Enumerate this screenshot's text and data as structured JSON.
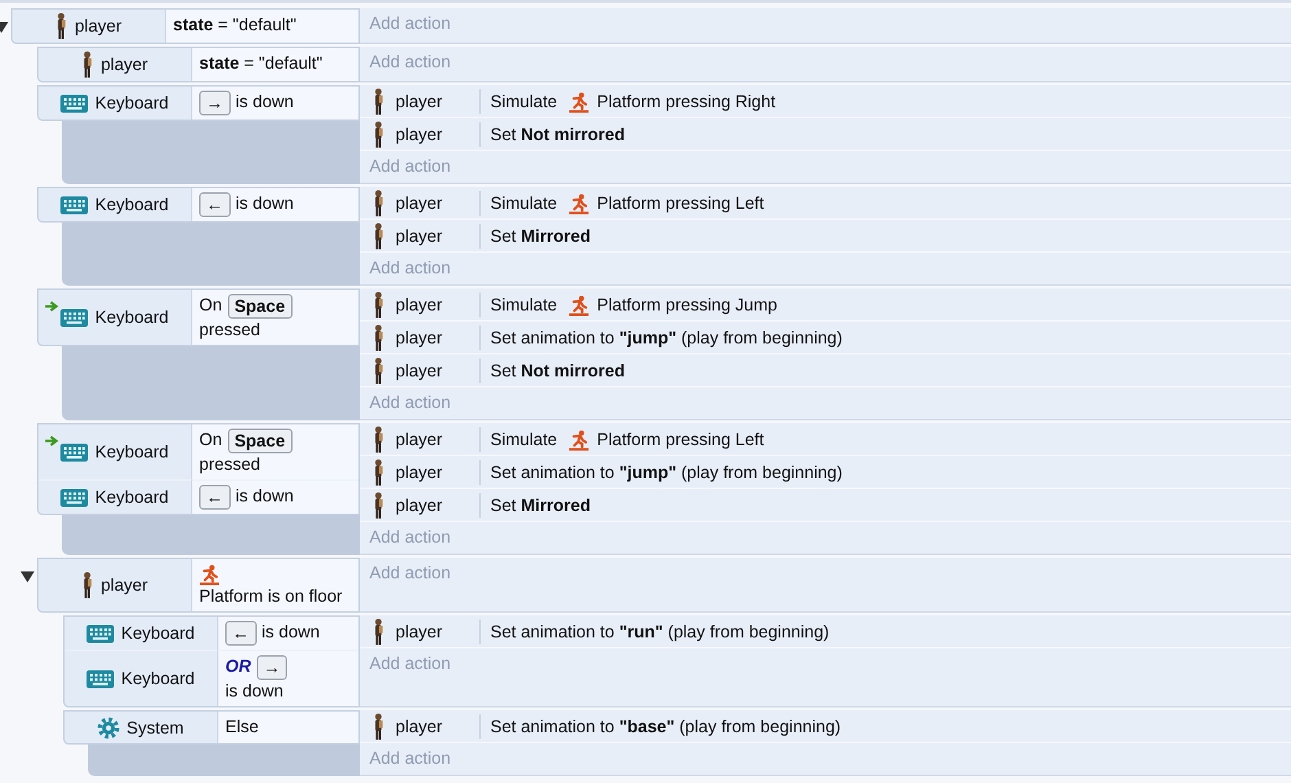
{
  "events": [
    {
      "expanded": true,
      "conditions": [
        {
          "object": "player",
          "kind": "sprite",
          "trigger": false,
          "parts": [
            {
              "kind": "text",
              "text": "**state** = \"default\""
            }
          ]
        }
      ],
      "add_action": "Add action",
      "children": [
        {
          "conditions": [
            {
              "object": "player",
              "kind": "sprite",
              "trigger": false,
              "parts": [
                {
                  "kind": "text",
                  "text": "**state** = \"default\""
                }
              ]
            }
          ],
          "add_action": "Add action"
        },
        {
          "conditions": [
            {
              "object": "Keyboard",
              "kind": "keyboard",
              "trigger": false,
              "parts": [
                {
                  "kind": "key",
                  "text": "→"
                },
                {
                  "kind": "text",
                  "text": "is down"
                }
              ]
            }
          ],
          "actions": [
            {
              "object": "player",
              "kind": "sprite",
              "parts": [
                {
                  "kind": "text",
                  "text": "Simulate"
                },
                {
                  "kind": "behavior"
                },
                {
                  "kind": "text",
                  "text": "Platform pressing Right"
                }
              ]
            },
            {
              "object": "player",
              "kind": "sprite",
              "parts": [
                {
                  "kind": "text",
                  "text": "Set **Not mirrored**"
                }
              ]
            }
          ],
          "add_action": "Add action"
        },
        {
          "conditions": [
            {
              "object": "Keyboard",
              "kind": "keyboard",
              "trigger": false,
              "parts": [
                {
                  "kind": "key",
                  "text": "←"
                },
                {
                  "kind": "text",
                  "text": "is down"
                }
              ]
            }
          ],
          "actions": [
            {
              "object": "player",
              "kind": "sprite",
              "parts": [
                {
                  "kind": "text",
                  "text": "Simulate"
                },
                {
                  "kind": "behavior"
                },
                {
                  "kind": "text",
                  "text": "Platform pressing Left"
                }
              ]
            },
            {
              "object": "player",
              "kind": "sprite",
              "parts": [
                {
                  "kind": "text",
                  "text": "Set **Mirrored**"
                }
              ]
            }
          ],
          "add_action": "Add action"
        },
        {
          "conditions": [
            {
              "object": "Keyboard",
              "kind": "keyboard",
              "trigger": true,
              "parts": [
                {
                  "kind": "text",
                  "text": "On"
                },
                {
                  "kind": "key",
                  "text": "Space"
                },
                {
                  "kind": "text",
                  "text": "pressed"
                }
              ]
            }
          ],
          "actions": [
            {
              "object": "player",
              "kind": "sprite",
              "parts": [
                {
                  "kind": "text",
                  "text": "Simulate"
                },
                {
                  "kind": "behavior"
                },
                {
                  "kind": "text",
                  "text": "Platform pressing Jump"
                }
              ]
            },
            {
              "object": "player",
              "kind": "sprite",
              "parts": [
                {
                  "kind": "text",
                  "text": "Set animation to **\"jump\"** (play from beginning)"
                }
              ]
            },
            {
              "object": "player",
              "kind": "sprite",
              "parts": [
                {
                  "kind": "text",
                  "text": "Set **Not mirrored**"
                }
              ]
            }
          ],
          "add_action": "Add action"
        },
        {
          "conditions": [
            {
              "object": "Keyboard",
              "kind": "keyboard",
              "trigger": true,
              "parts": [
                {
                  "kind": "text",
                  "text": "On"
                },
                {
                  "kind": "key",
                  "text": "Space"
                },
                {
                  "kind": "text",
                  "text": "pressed"
                }
              ]
            },
            {
              "object": "Keyboard",
              "kind": "keyboard",
              "trigger": false,
              "parts": [
                {
                  "kind": "key",
                  "text": "←"
                },
                {
                  "kind": "text",
                  "text": "is down"
                }
              ]
            }
          ],
          "actions": [
            {
              "object": "player",
              "kind": "sprite",
              "parts": [
                {
                  "kind": "text",
                  "text": "Simulate"
                },
                {
                  "kind": "behavior"
                },
                {
                  "kind": "text",
                  "text": "Platform pressing Left"
                }
              ]
            },
            {
              "object": "player",
              "kind": "sprite",
              "parts": [
                {
                  "kind": "text",
                  "text": "Set animation to **\"jump\"** (play from beginning)"
                }
              ]
            },
            {
              "object": "player",
              "kind": "sprite",
              "parts": [
                {
                  "kind": "text",
                  "text": "Set **Mirrored**"
                }
              ]
            }
          ],
          "add_action": "Add action"
        },
        {
          "expanded": true,
          "conditions": [
            {
              "object": "player",
              "kind": "sprite",
              "trigger": false,
              "parts": [
                {
                  "kind": "behavior"
                },
                {
                  "kind": "text",
                  "text": "Platform is on floor"
                }
              ]
            }
          ],
          "add_action": "Add action",
          "children": [
            {
              "conditions": [
                {
                  "object": "Keyboard",
                  "kind": "keyboard",
                  "trigger": false,
                  "parts": [
                    {
                      "kind": "key",
                      "text": "←"
                    },
                    {
                      "kind": "text",
                      "text": "is down"
                    }
                  ]
                },
                {
                  "object": "Keyboard",
                  "kind": "keyboard",
                  "trigger": false,
                  "parts": [
                    {
                      "kind": "or",
                      "text": "OR"
                    },
                    {
                      "kind": "key",
                      "text": "→"
                    },
                    {
                      "kind": "text",
                      "text": "is down"
                    }
                  ]
                }
              ],
              "actions": [
                {
                  "object": "player",
                  "kind": "sprite",
                  "parts": [
                    {
                      "kind": "text",
                      "text": "Set animation to **\"run\"** (play from beginning)"
                    }
                  ]
                }
              ],
              "add_action": "Add action"
            },
            {
              "conditions": [
                {
                  "object": "System",
                  "kind": "system",
                  "trigger": false,
                  "parts": [
                    {
                      "kind": "text",
                      "text": "Else"
                    }
                  ]
                }
              ],
              "actions": [
                {
                  "object": "player",
                  "kind": "sprite",
                  "parts": [
                    {
                      "kind": "text",
                      "text": "Set animation to **\"base\"** (play from beginning)"
                    }
                  ]
                }
              ],
              "add_action": "Add action"
            }
          ]
        }
      ]
    }
  ]
}
